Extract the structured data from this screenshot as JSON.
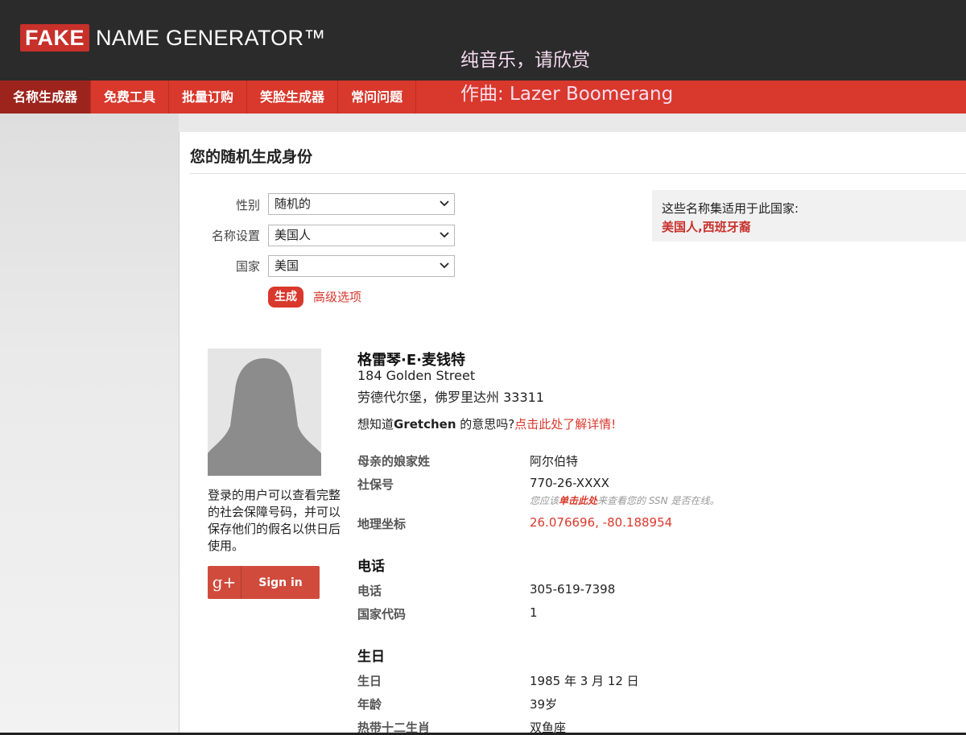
{
  "header": {
    "logo_fake": "FAKE",
    "logo_rest": "NAME GENERATOR™",
    "overlay_line1": "纯音乐，请欣赏",
    "overlay_line2": "作曲: Lazer Boomerang"
  },
  "nav": {
    "items": [
      {
        "label": "名称生成器"
      },
      {
        "label": "免费工具"
      },
      {
        "label": "批量订购"
      },
      {
        "label": "笑脸生成器"
      },
      {
        "label": "常问问题"
      }
    ]
  },
  "page_title": "您的随机生成身份",
  "form": {
    "gender_label": "性别",
    "gender_value": "随机的",
    "nameset_label": "名称设置",
    "nameset_value": "美国人",
    "country_label": "国家",
    "country_value": "美国",
    "generate_label": "生成",
    "advanced_label": "高级选项"
  },
  "info_box": {
    "line1": "这些名称集适用于此国家:",
    "line2": "美国人,西班牙裔"
  },
  "sidebar": {
    "note": "登录的用户可以查看完整的社会保障号码，并可以保存他们的假名以供日后使用。",
    "gplus_label": "Sign in"
  },
  "identity": {
    "name": "格雷琴·E·麦钱特",
    "street": "184 Golden Street",
    "city_line": "劳德代尔堡，佛罗里达州 33311",
    "meaning_prefix": "想知道",
    "meaning_name": "Gretchen",
    "meaning_mid": " 的意思吗?",
    "meaning_link": "点击此处了解详情!"
  },
  "details": {
    "mmn_label": "母亲的娘家姓",
    "mmn_value": "阿尔伯特",
    "ssn_label": "社保号",
    "ssn_value": "770-26-XXXX",
    "ssn_note_pre": "您应该",
    "ssn_note_link": "单击此处",
    "ssn_note_post": "来查看您的 SSN 是否在线。",
    "geo_label": "地理坐标",
    "geo_value": "26.076696, -80.188954"
  },
  "phone": {
    "section": "电话",
    "phone_label": "电话",
    "phone_value": "305-619-7398",
    "cc_label": "国家代码",
    "cc_value": "1"
  },
  "birthday": {
    "section": "生日",
    "bday_label": "生日",
    "bday_value": "1985 年 3 月 12 日",
    "age_label": "年龄",
    "age_value": "39岁",
    "zodiac_label": "热带十二生肖",
    "zodiac_value": "双鱼座"
  }
}
